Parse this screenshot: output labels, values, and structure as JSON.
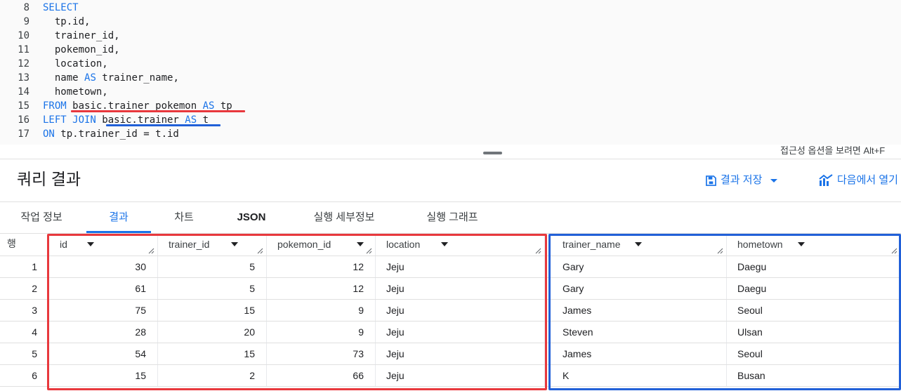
{
  "editor": {
    "lines": [
      {
        "num": "8",
        "tokens": [
          {
            "t": "SELECT",
            "k": "kw"
          }
        ]
      },
      {
        "num": "9",
        "tokens": [
          {
            "t": "  tp.id,",
            "k": "tx"
          }
        ]
      },
      {
        "num": "10",
        "tokens": [
          {
            "t": "  trainer_id,",
            "k": "tx"
          }
        ]
      },
      {
        "num": "11",
        "tokens": [
          {
            "t": "  pokemon_id,",
            "k": "tx"
          }
        ]
      },
      {
        "num": "12",
        "tokens": [
          {
            "t": "  location,",
            "k": "tx"
          }
        ]
      },
      {
        "num": "13",
        "tokens": [
          {
            "t": "  name ",
            "k": "tx"
          },
          {
            "t": "AS",
            "k": "kw"
          },
          {
            "t": " trainer_name,",
            "k": "tx"
          }
        ]
      },
      {
        "num": "14",
        "tokens": [
          {
            "t": "  hometown,",
            "k": "tx"
          }
        ]
      },
      {
        "num": "15",
        "tokens": [
          {
            "t": "FROM",
            "k": "kw"
          },
          {
            "t": " basic.trainer_pokemon ",
            "k": "tx"
          },
          {
            "t": "AS",
            "k": "kw"
          },
          {
            "t": " tp",
            "k": "tx"
          }
        ]
      },
      {
        "num": "16",
        "tokens": [
          {
            "t": "LEFT JOIN",
            "k": "kw"
          },
          {
            "t": " basic.trainer ",
            "k": "tx"
          },
          {
            "t": "AS",
            "k": "kw"
          },
          {
            "t": " t",
            "k": "tx"
          }
        ]
      },
      {
        "num": "17",
        "tokens": [
          {
            "t": "ON",
            "k": "kw"
          },
          {
            "t": " tp.trainer_id = t.id",
            "k": "tx"
          }
        ]
      }
    ],
    "accessibility_hint": "접근성 옵션을 보려면 Alt+F"
  },
  "results": {
    "title": "쿼리 결과",
    "save_label": "결과 저장",
    "open_in_label": "다음에서 열기"
  },
  "tabs": [
    {
      "label": "작업 정보"
    },
    {
      "label": "결과"
    },
    {
      "label": "차트"
    },
    {
      "label": "JSON"
    },
    {
      "label": "실행 세부정보"
    },
    {
      "label": "실행 그래프"
    }
  ],
  "table": {
    "row_header": "행",
    "columns": [
      "id",
      "trainer_id",
      "pokemon_id",
      "location",
      "trainer_name",
      "hometown"
    ],
    "rows": [
      {
        "n": "1",
        "cells": [
          "30",
          "5",
          "12",
          "Jeju",
          "Gary",
          "Daegu"
        ]
      },
      {
        "n": "2",
        "cells": [
          "61",
          "5",
          "12",
          "Jeju",
          "Gary",
          "Daegu"
        ]
      },
      {
        "n": "3",
        "cells": [
          "75",
          "15",
          "9",
          "Jeju",
          "James",
          "Seoul"
        ]
      },
      {
        "n": "4",
        "cells": [
          "28",
          "20",
          "9",
          "Jeju",
          "Steven",
          "Ulsan"
        ]
      },
      {
        "n": "5",
        "cells": [
          "54",
          "15",
          "73",
          "Jeju",
          "James",
          "Seoul"
        ]
      },
      {
        "n": "6",
        "cells": [
          "15",
          "2",
          "66",
          "Jeju",
          "K",
          "Busan"
        ]
      }
    ]
  },
  "colors": {
    "accent": "#1a73e8",
    "annotation_red": "#e8383d",
    "annotation_blue": "#2160d8"
  },
  "icons": [
    "save-icon",
    "dropdown-caret-icon",
    "chart-explore-icon",
    "sort-caret-icon",
    "resize-grip-icon"
  ]
}
